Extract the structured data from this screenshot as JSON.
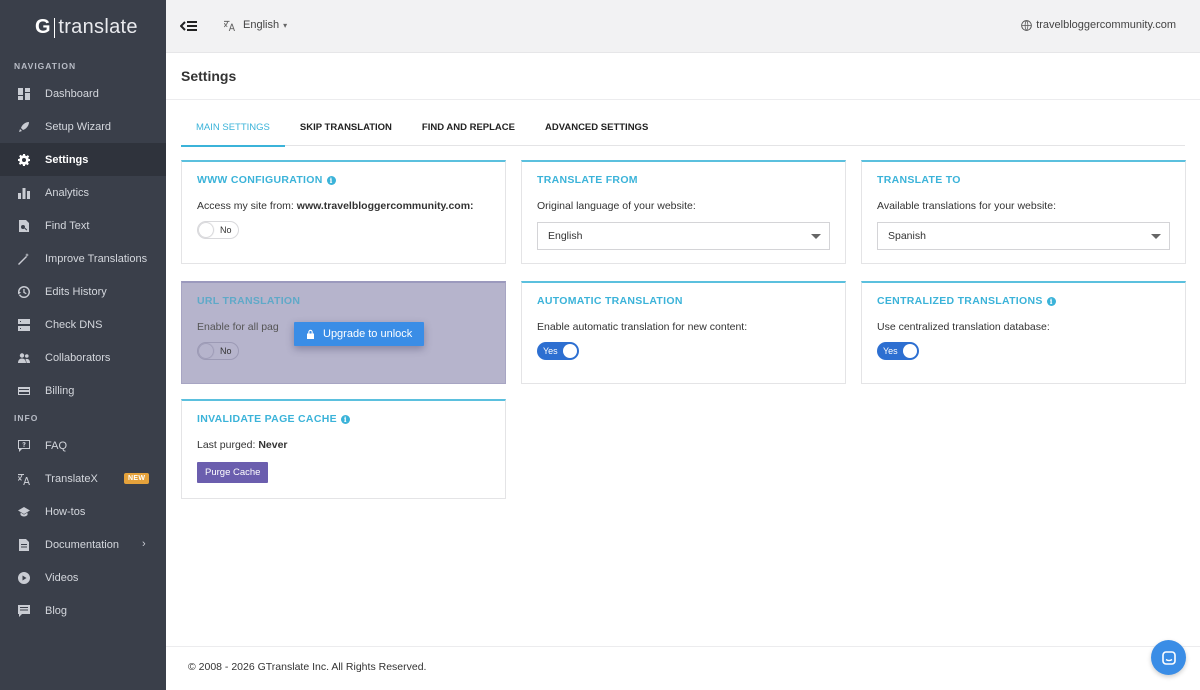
{
  "brand": {
    "g": "G",
    "rest": "translate"
  },
  "sidebar": {
    "nav_heading": "NAVIGATION",
    "info_heading": "INFO",
    "nav_items": [
      {
        "label": "Dashboard",
        "icon": "dashboard-icon"
      },
      {
        "label": "Setup Wizard",
        "icon": "rocket-icon"
      },
      {
        "label": "Settings",
        "icon": "gear-icon",
        "active": true
      },
      {
        "label": "Analytics",
        "icon": "bar-chart-icon"
      },
      {
        "label": "Find Text",
        "icon": "document-search-icon"
      },
      {
        "label": "Improve Translations",
        "icon": "magic-wand-icon"
      },
      {
        "label": "Edits History",
        "icon": "history-icon"
      },
      {
        "label": "Check DNS",
        "icon": "server-icon"
      },
      {
        "label": "Collaborators",
        "icon": "users-icon"
      },
      {
        "label": "Billing",
        "icon": "credit-card-icon"
      }
    ],
    "info_items": [
      {
        "label": "FAQ",
        "icon": "question-bubble-icon"
      },
      {
        "label": "TranslateX",
        "icon": "translate-icon",
        "badge": "NEW"
      },
      {
        "label": "How-tos",
        "icon": "graduation-cap-icon"
      },
      {
        "label": "Documentation",
        "icon": "document-icon",
        "chevron": "›"
      },
      {
        "label": "Videos",
        "icon": "play-icon"
      },
      {
        "label": "Blog",
        "icon": "blog-icon"
      }
    ]
  },
  "topbar": {
    "language": "English",
    "site": "travelbloggercommunity.com"
  },
  "page": {
    "title": "Settings",
    "tabs": [
      "MAIN SETTINGS",
      "SKIP TRANSLATION",
      "FIND AND REPLACE",
      "ADVANCED SETTINGS"
    ],
    "active_tab": "MAIN SETTINGS"
  },
  "cards": {
    "www": {
      "title": "WWW CONFIGURATION",
      "text_prefix": "Access my site from:",
      "text_value": "www.travelbloggercommunity.com:",
      "toggle": "No"
    },
    "from": {
      "title": "TRANSLATE FROM",
      "text": "Original language of your website:",
      "value": "English"
    },
    "to": {
      "title": "TRANSLATE TO",
      "text": "Available translations for your website:",
      "value": "Spanish"
    },
    "url": {
      "title": "URL TRANSLATION",
      "text": "Enable for all pag",
      "toggle": "No",
      "upgrade": "Upgrade to unlock"
    },
    "auto": {
      "title": "AUTOMATIC TRANSLATION",
      "text": "Enable automatic translation for new content:",
      "toggle": "Yes"
    },
    "central": {
      "title": "CENTRALIZED TRANSLATIONS",
      "text": "Use centralized translation database:",
      "toggle": "Yes"
    },
    "cache": {
      "title": "INVALIDATE PAGE CACHE",
      "text_prefix": "Last purged:",
      "text_value": "Never",
      "button": "Purge Cache"
    }
  },
  "footer": "© 2008 - 2026 GTranslate Inc. All Rights Reserved.",
  "colors": {
    "sidebar_bg": "#3a3f4a",
    "accent": "#3bb3d9",
    "toggle_on": "#2d6fd1",
    "purge_button": "#6b5eae",
    "badge_new": "#e5a23b"
  }
}
